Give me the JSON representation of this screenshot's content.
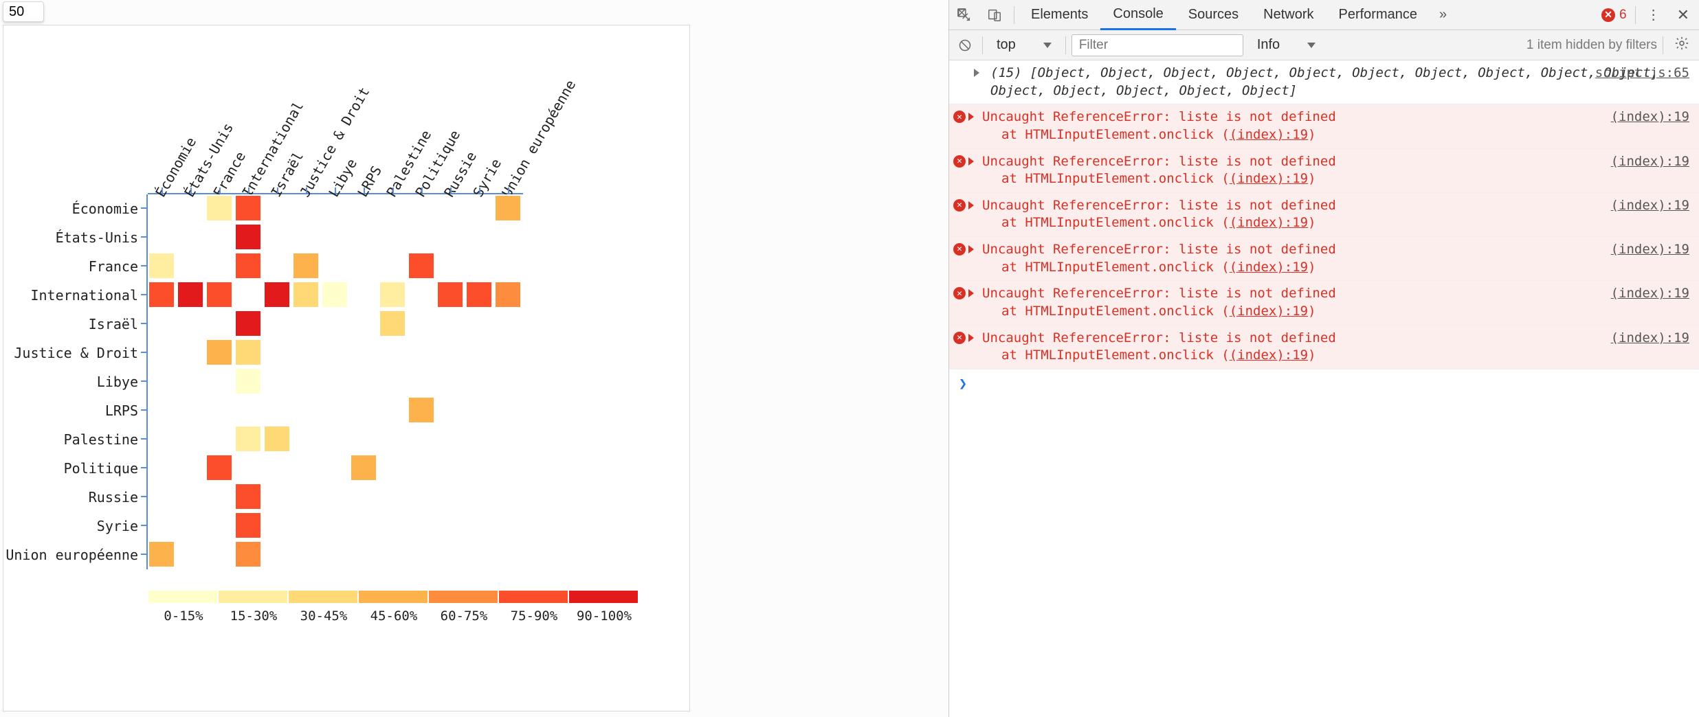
{
  "input_value": "50",
  "devtools": {
    "tabs": [
      "Elements",
      "Console",
      "Sources",
      "Network",
      "Performance"
    ],
    "active_tab": "Console",
    "more_glyph": "»",
    "error_count": "6",
    "toolbar": {
      "context": "top",
      "filter_placeholder": "Filter",
      "level": "Info",
      "hidden_note": "1 item hidden by filters"
    },
    "log": {
      "info_source": "script.js:65",
      "info_text": "(15) [Object, Object, Object, Object, Object, Object, Object, Object, Object, Object, Object, Object, Object, Object, Object]",
      "error_message": "Uncaught ReferenceError: liste is not defined",
      "error_at_prefix": "    at HTMLInputElement.onclick (",
      "error_at_link": "(index):19",
      "error_at_suffix": ")",
      "error_source": "(index):19",
      "error_repeat": 6
    }
  },
  "chart_data": {
    "type": "heatmap",
    "categories": [
      "Économie",
      "États-Unis",
      "France",
      "International",
      "Israël",
      "Justice & Droit",
      "Libye",
      "LRPS",
      "Palestine",
      "Politique",
      "Russie",
      "Syrie",
      "Union européenne"
    ],
    "legend": {
      "labels": [
        "0-15%",
        "15-30%",
        "30-45%",
        "45-60%",
        "60-75%",
        "75-90%",
        "90-100%"
      ],
      "colors": [
        "#ffffcc",
        "#ffeda0",
        "#fed976",
        "#feb24c",
        "#fd8d3c",
        "#fc4e2a",
        "#e31a1c"
      ]
    },
    "cells": [
      {
        "r": 0,
        "c": 2,
        "b": 1
      },
      {
        "r": 0,
        "c": 3,
        "b": 5
      },
      {
        "r": 0,
        "c": 12,
        "b": 3
      },
      {
        "r": 1,
        "c": 3,
        "b": 6
      },
      {
        "r": 2,
        "c": 0,
        "b": 1
      },
      {
        "r": 2,
        "c": 3,
        "b": 5
      },
      {
        "r": 2,
        "c": 5,
        "b": 3
      },
      {
        "r": 2,
        "c": 9,
        "b": 5
      },
      {
        "r": 3,
        "c": 0,
        "b": 5
      },
      {
        "r": 3,
        "c": 1,
        "b": 6
      },
      {
        "r": 3,
        "c": 2,
        "b": 5
      },
      {
        "r": 3,
        "c": 4,
        "b": 6
      },
      {
        "r": 3,
        "c": 5,
        "b": 2
      },
      {
        "r": 3,
        "c": 6,
        "b": 0
      },
      {
        "r": 3,
        "c": 8,
        "b": 1
      },
      {
        "r": 3,
        "c": 10,
        "b": 5
      },
      {
        "r": 3,
        "c": 11,
        "b": 5
      },
      {
        "r": 3,
        "c": 12,
        "b": 4
      },
      {
        "r": 4,
        "c": 3,
        "b": 6
      },
      {
        "r": 4,
        "c": 8,
        "b": 2
      },
      {
        "r": 5,
        "c": 2,
        "b": 3
      },
      {
        "r": 5,
        "c": 3,
        "b": 2
      },
      {
        "r": 6,
        "c": 3,
        "b": 0
      },
      {
        "r": 7,
        "c": 9,
        "b": 3
      },
      {
        "r": 8,
        "c": 3,
        "b": 1
      },
      {
        "r": 8,
        "c": 4,
        "b": 2
      },
      {
        "r": 9,
        "c": 2,
        "b": 5
      },
      {
        "r": 9,
        "c": 7,
        "b": 3
      },
      {
        "r": 10,
        "c": 3,
        "b": 5
      },
      {
        "r": 11,
        "c": 3,
        "b": 5
      },
      {
        "r": 12,
        "c": 0,
        "b": 3
      },
      {
        "r": 12,
        "c": 3,
        "b": 4
      }
    ]
  }
}
